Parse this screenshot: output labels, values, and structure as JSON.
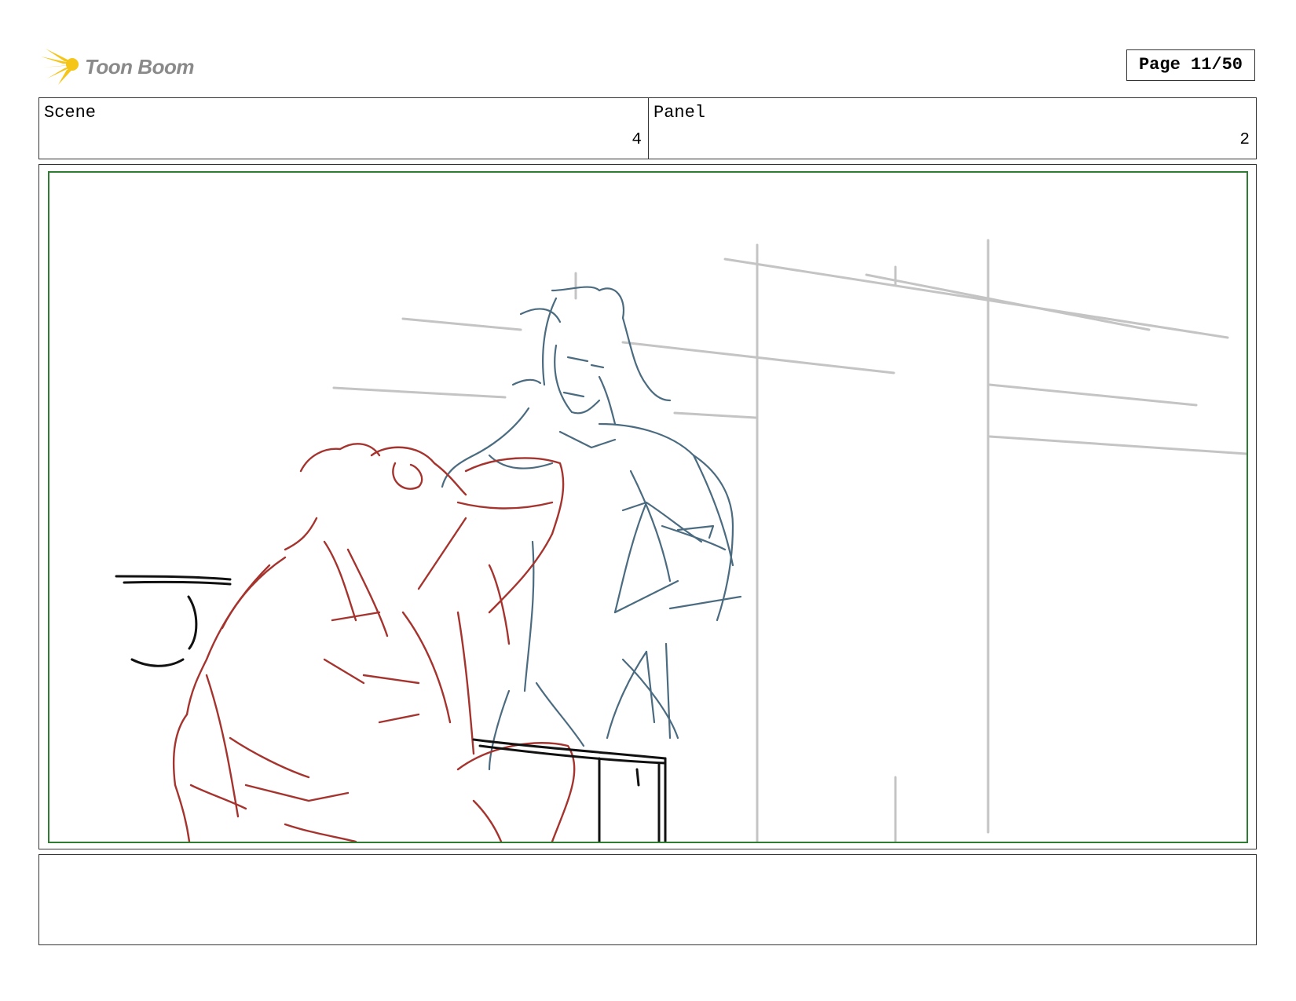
{
  "brand": {
    "name": "Toon Boom",
    "accent": "#f5c518",
    "text_color": "#8a8a8a"
  },
  "page": {
    "label": "Page 11/50"
  },
  "header": {
    "scene_label": "Scene",
    "scene_value": "4",
    "panel_label": "Panel",
    "panel_value": "2"
  },
  "frame": {
    "border_color": "#2e7d32"
  },
  "sketch": {
    "colors": {
      "background_lines": "#c4c4c4",
      "standing_figure": "#4a6b80",
      "seated_figure": "#a5332e",
      "props": "#111111"
    }
  },
  "notes": {
    "text": ""
  }
}
